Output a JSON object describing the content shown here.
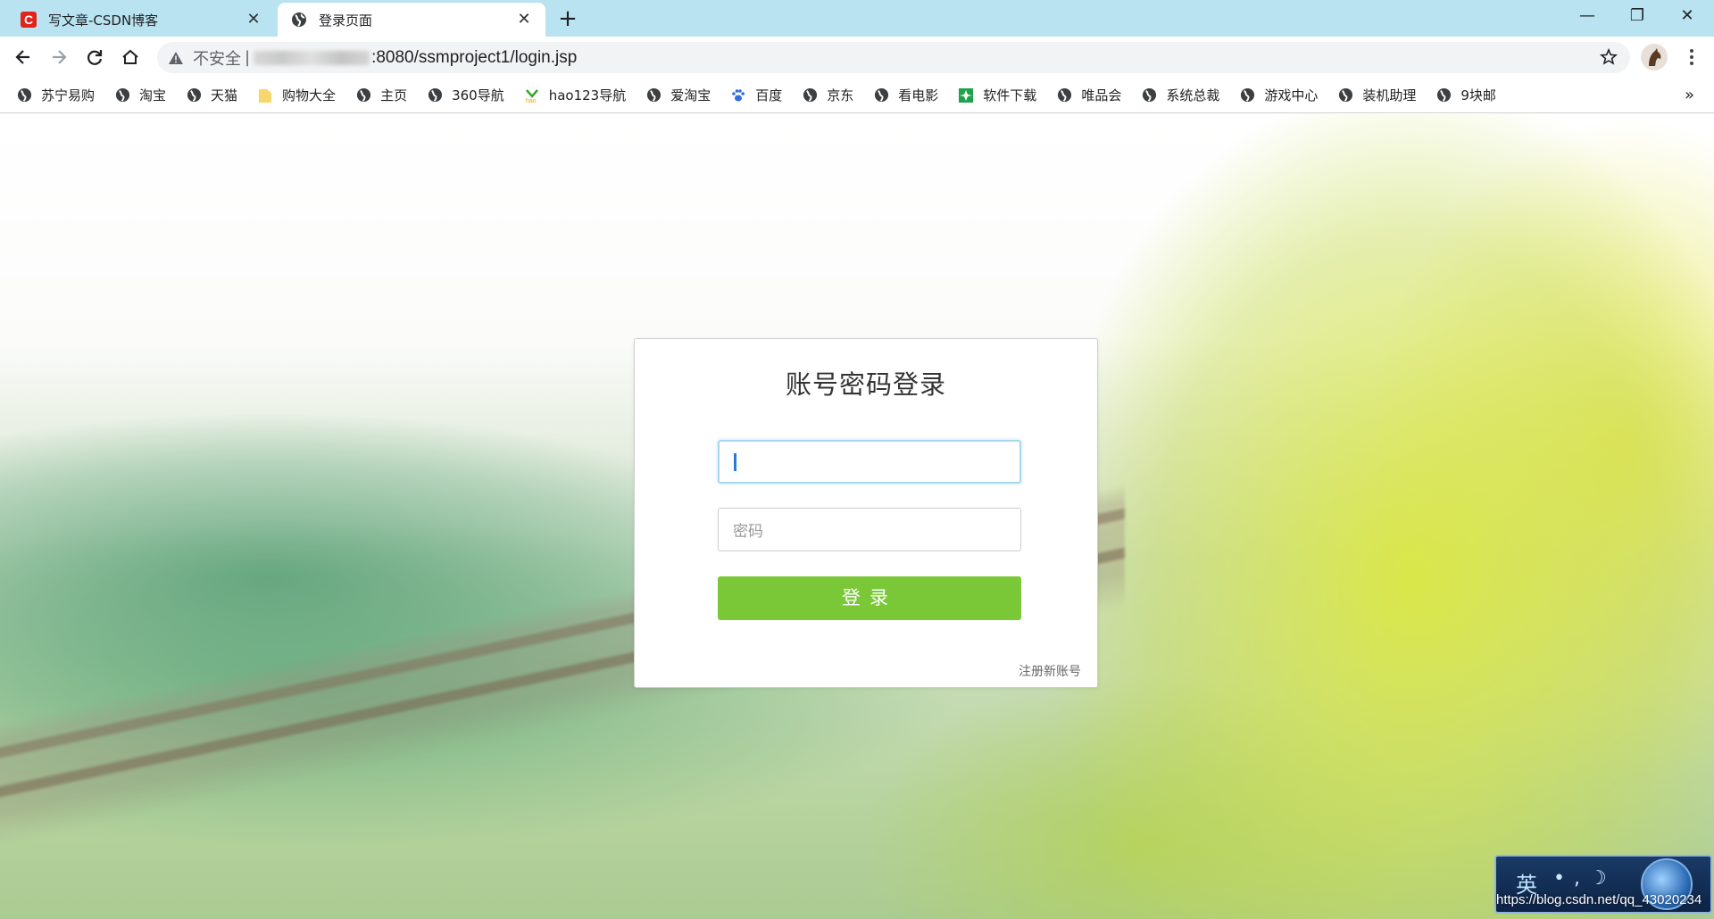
{
  "browser": {
    "tabs": [
      {
        "title": "写文章-CSDN博客",
        "favicon": "csdn-icon",
        "active": false
      },
      {
        "title": "登录页面",
        "favicon": "globe-icon",
        "active": true
      }
    ],
    "new_tab": "+",
    "window_controls": {
      "minimize": "—",
      "restore": "❐",
      "close": "✕"
    },
    "address": {
      "security_label": "不安全",
      "separator": "|",
      "url_visible": ":8080/ssmproject1/login.jsp"
    },
    "bookmarks": [
      {
        "label": "苏宁易购",
        "icon": "globe-icon"
      },
      {
        "label": "淘宝",
        "icon": "globe-icon"
      },
      {
        "label": "天猫",
        "icon": "globe-icon"
      },
      {
        "label": "购物大全",
        "icon": "folder-icon"
      },
      {
        "label": "主页",
        "icon": "globe-icon"
      },
      {
        "label": "360导航",
        "icon": "globe-icon"
      },
      {
        "label": "hao123导航",
        "icon": "hao123-icon"
      },
      {
        "label": "爱淘宝",
        "icon": "globe-icon"
      },
      {
        "label": "百度",
        "icon": "baidu-paw-icon"
      },
      {
        "label": "京东",
        "icon": "globe-icon"
      },
      {
        "label": "看电影",
        "icon": "globe-icon"
      },
      {
        "label": "软件下载",
        "icon": "software-icon"
      },
      {
        "label": "唯品会",
        "icon": "globe-icon"
      },
      {
        "label": "系统总裁",
        "icon": "globe-icon"
      },
      {
        "label": "游戏中心",
        "icon": "globe-icon"
      },
      {
        "label": "装机助理",
        "icon": "globe-icon"
      },
      {
        "label": "9块邮",
        "icon": "globe-icon"
      }
    ],
    "bookmarks_more": "»"
  },
  "login": {
    "title": "账号密码登录",
    "username_value": "",
    "password_placeholder": "密码",
    "submit_label": "登录",
    "register_link": "注册新账号"
  },
  "ime": {
    "mode": "英",
    "symbols": "•,☽"
  },
  "watermark": "https://blog.csdn.net/qq_43020234",
  "colors": {
    "tabstrip": "#b9e3f0",
    "login_button": "#7ac837",
    "input_focus_border": "#a8d8ee"
  }
}
